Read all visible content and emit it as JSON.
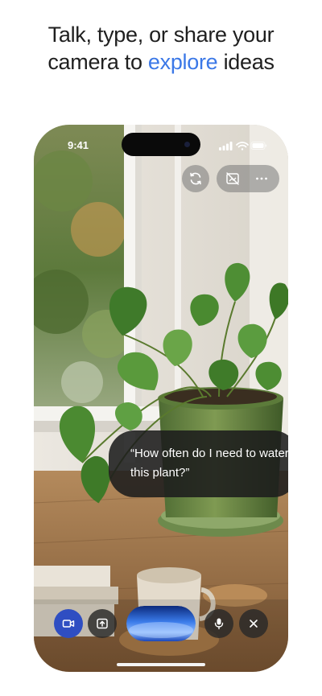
{
  "headline": {
    "line1": "Talk, type, or share your",
    "line2_before": "camera to ",
    "line2_accent": "explore",
    "line2_after": " ideas"
  },
  "status_bar": {
    "time": "9:41"
  },
  "camera_prompt": {
    "text": "“How often do I need to water this plant?”"
  },
  "colors": {
    "accent": "#3b78e7",
    "video_button": "#2f4ec2",
    "bubble_bg": "#1c1c1c"
  },
  "icons": {
    "top_controls": [
      "switch-camera-icon",
      "screen-share-off-icon",
      "more-icon"
    ],
    "bottom_controls": [
      "video-icon",
      "share-screen-icon",
      "gemini-wave",
      "mic-icon",
      "close-icon"
    ]
  }
}
